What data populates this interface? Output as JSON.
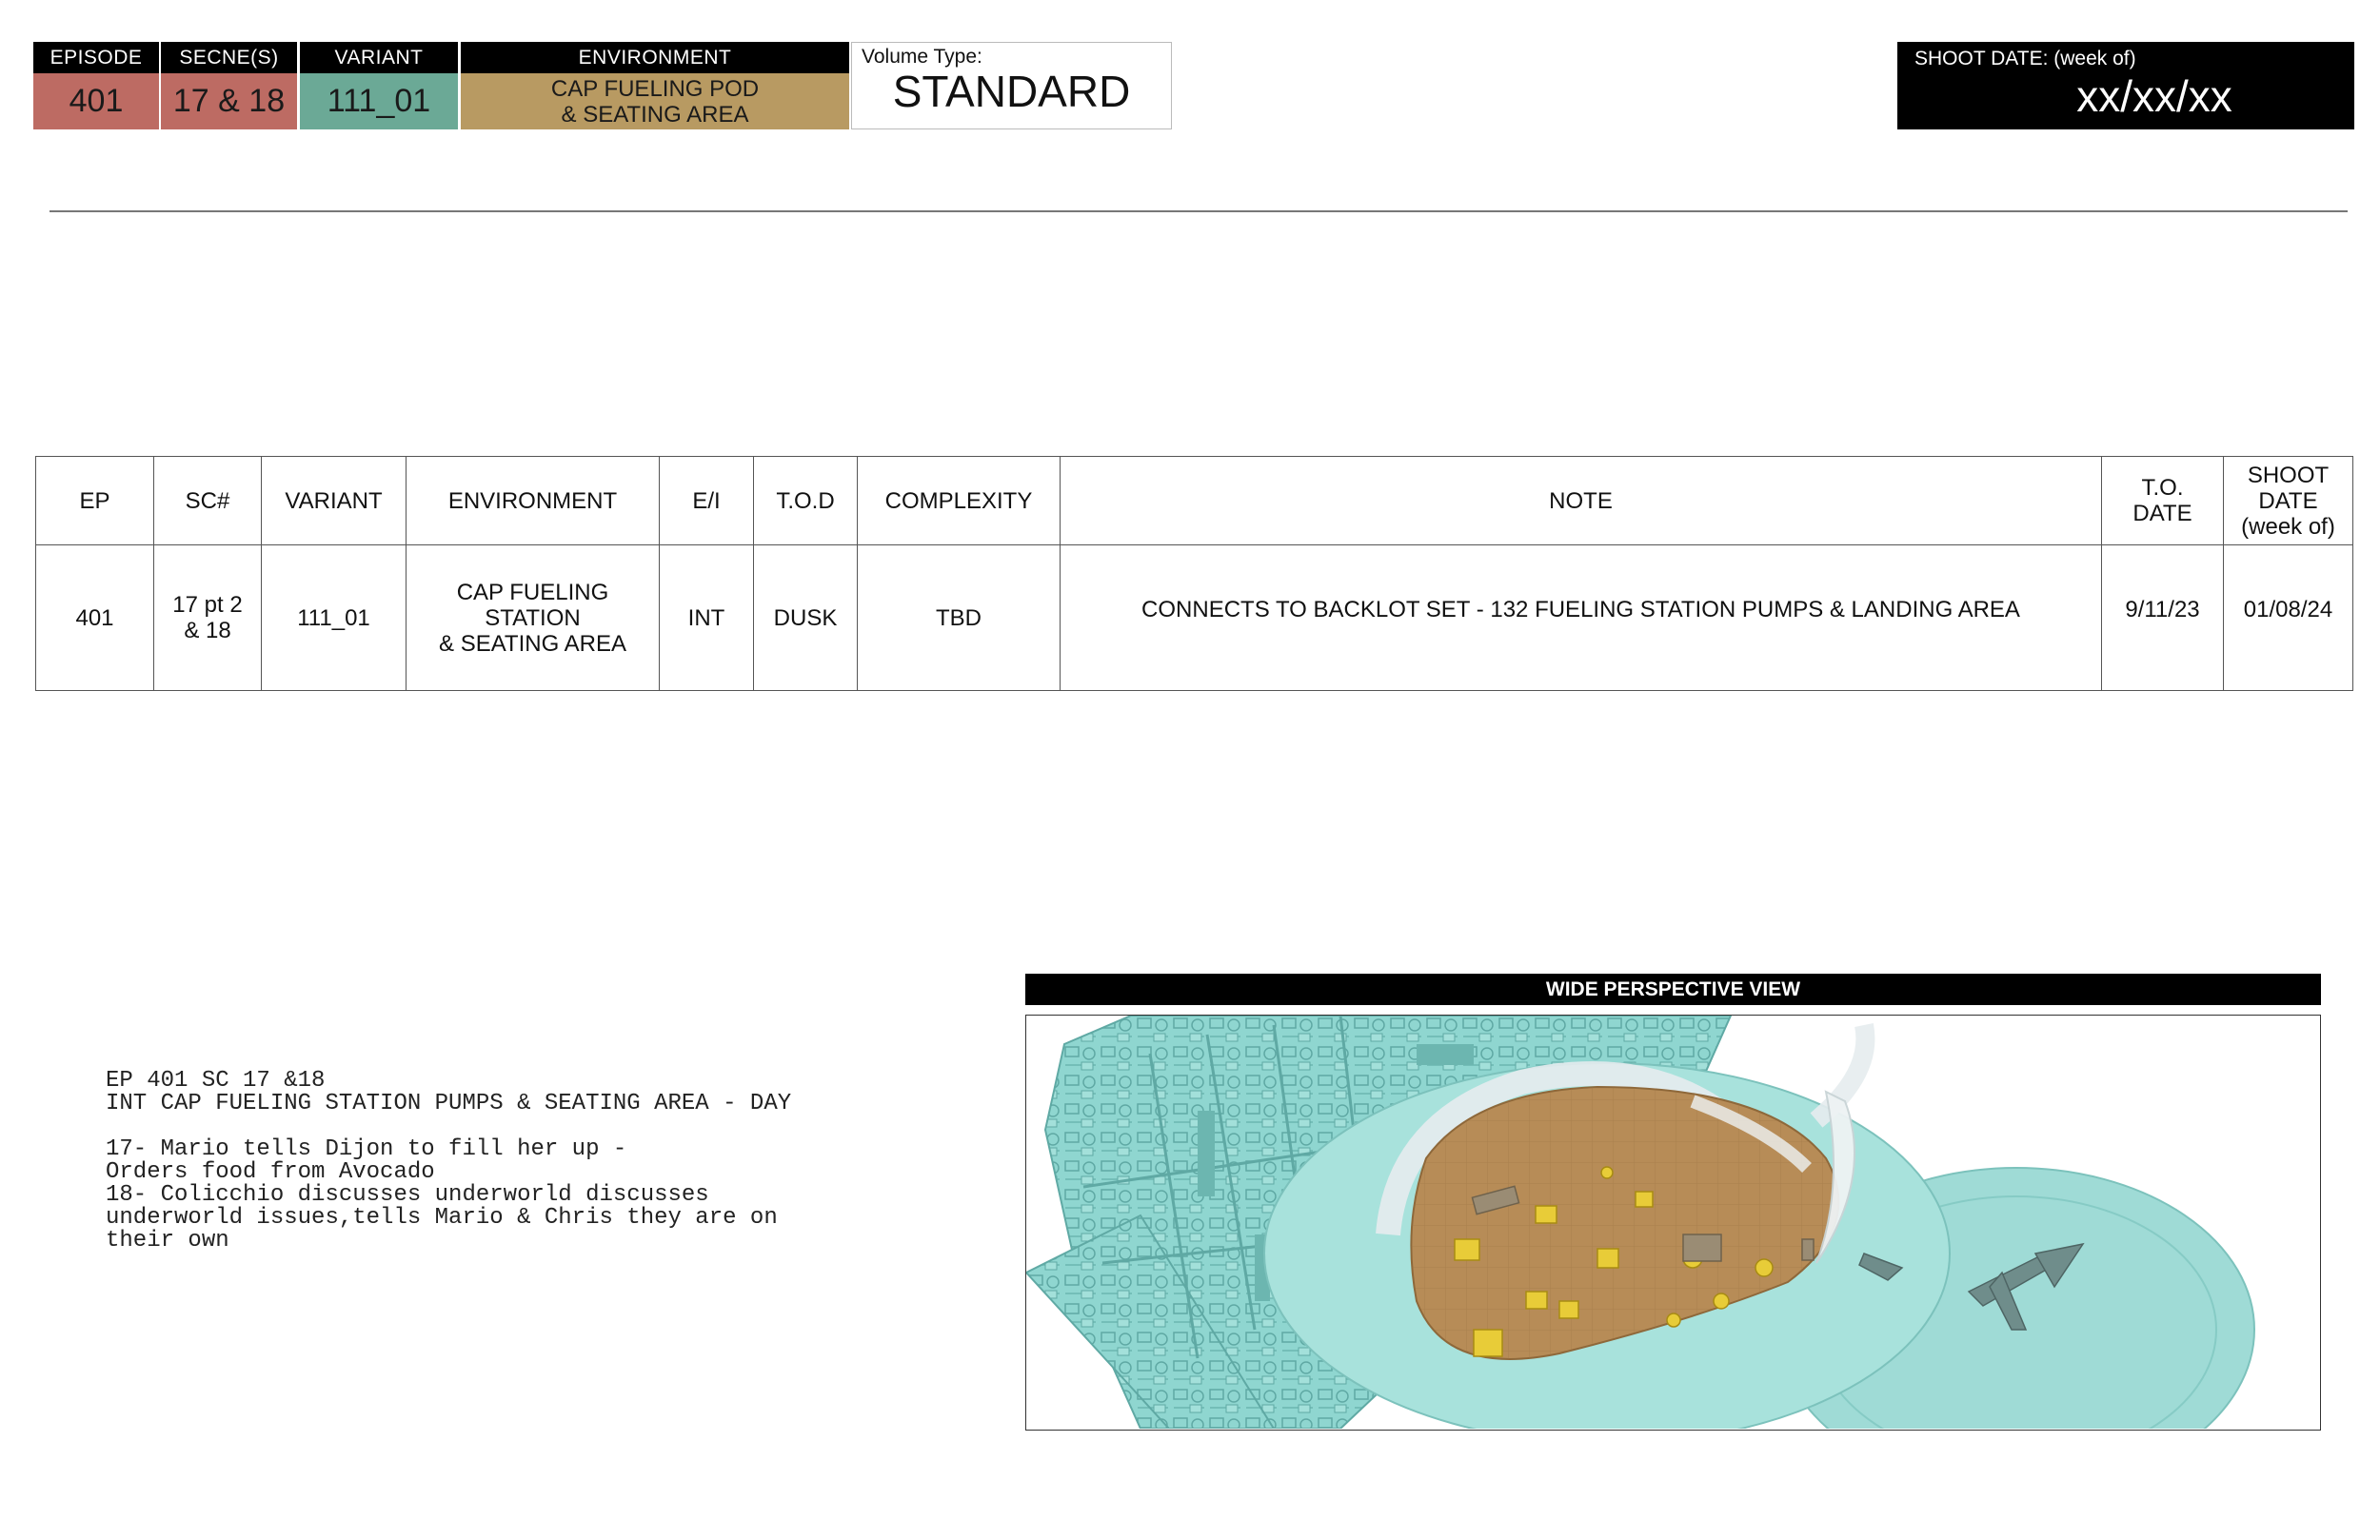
{
  "header": {
    "episode": {
      "label": "EPISODE",
      "value": "401"
    },
    "scenes": {
      "label": "SECNE(S)",
      "value": "17 & 18"
    },
    "variant": {
      "label": "VARIANT",
      "value": "111_01"
    },
    "environment": {
      "label": "ENVIRONMENT",
      "value_line1": "CAP FUELING POD",
      "value_line2": "& SEATING AREA"
    },
    "volume_type": {
      "label": "Volume Type:",
      "value": "STANDARD"
    },
    "shoot_date": {
      "label": "SHOOT DATE: (week of)",
      "value": "xx/xx/xx"
    },
    "colors": {
      "episode": "#bd6b63",
      "variant": "#6ba996",
      "environment": "#b89a62"
    }
  },
  "schedule": {
    "headers": {
      "ep": "EP",
      "sc": "SC#",
      "variant": "VARIANT",
      "environment": "ENVIRONMENT",
      "ei": "E/I",
      "tod": "T.O.D",
      "complexity": "COMPLEXITY",
      "note": "NOTE",
      "to_date_1": "T.O.",
      "to_date_2": "DATE",
      "shoot_1": "SHOOT",
      "shoot_2": "DATE",
      "shoot_3": "(week of)"
    },
    "row": {
      "ep": "401",
      "sc_1": "17 pt 2",
      "sc_2": "& 18",
      "variant": "111_01",
      "env_1": "CAP FUELING STATION",
      "env_2": "& SEATING AREA",
      "ei": "INT",
      "tod": "DUSK",
      "complexity": "TBD",
      "note": "CONNECTS TO BACKLOT SET - 132 FUELING STATION PUMPS & LANDING AREA",
      "to_date": "9/11/23",
      "shoot_date": "01/08/24"
    }
  },
  "script": {
    "line1": "EP 401 SC 17 &18",
    "line2": "INT CAP FUELING STATION PUMPS & SEATING AREA - DAY",
    "line3": "17- Mario tells Dijon to fill her up -",
    "line4": "Orders food from Avocado",
    "line5": "18- Colicchio discusses underworld discusses",
    "line6": "underworld issues,tells Mario & Chris they are on",
    "line7": "their own"
  },
  "view": {
    "title": "WIDE PERSPECTIVE VIEW",
    "colors": {
      "structure": "#8fd6d0",
      "structure_dark": "#5fa9a4",
      "floor": "#b78c57",
      "props": "#e8cc38",
      "glass": "#e6ecee"
    }
  }
}
